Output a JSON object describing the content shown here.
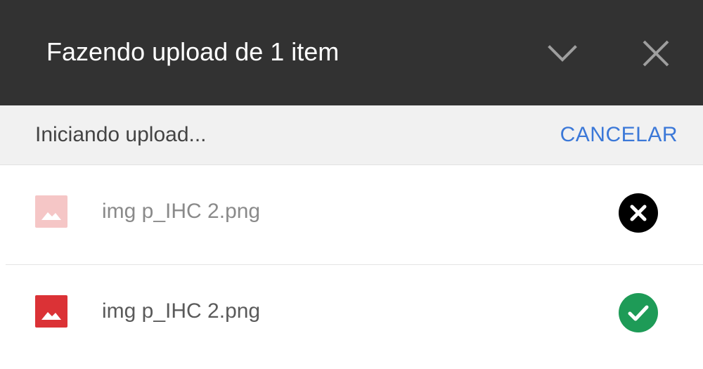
{
  "header": {
    "title": "Fazendo upload de 1 item",
    "collapse_icon": "chevron-down-icon",
    "close_icon": "close-icon"
  },
  "status": {
    "text": "Iniciando upload...",
    "cancel_label": "CANCELAR"
  },
  "files": [
    {
      "name": "img p_IHC 2.png",
      "type_icon": "image-file-icon",
      "state_icon": "error-x-icon",
      "faded": true
    },
    {
      "name": "img p_IHC 2.png",
      "type_icon": "image-file-icon",
      "state_icon": "success-check-icon",
      "faded": false
    }
  ],
  "colors": {
    "header_bg": "#323232",
    "accent": "#3b78d8",
    "image_icon": "#db3236",
    "image_icon_faded": "#f5c6c6",
    "success": "#1e9b57",
    "error": "#000000"
  }
}
